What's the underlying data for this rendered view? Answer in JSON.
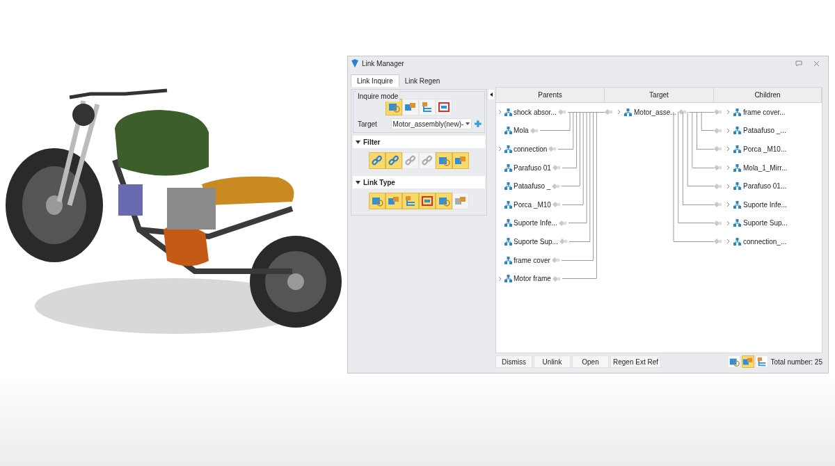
{
  "window": {
    "title": "Link Manager"
  },
  "tabs": [
    {
      "label": "Link Inquire",
      "selected": true
    },
    {
      "label": "Link Regen",
      "selected": false
    }
  ],
  "inquire_mode": {
    "label": "Inquire mode",
    "modes": [
      {
        "selected": true
      },
      {
        "selected": false
      },
      {
        "selected": false
      },
      {
        "selected": false
      }
    ],
    "target_label": "Target",
    "target_value": "Motor_assembly(new)-"
  },
  "filter": {
    "label": "Filter",
    "expanded": true,
    "toggles": [
      {
        "on": true
      },
      {
        "on": true
      },
      {
        "on": false
      },
      {
        "on": false
      },
      {
        "on": true
      },
      {
        "on": true
      }
    ]
  },
  "link_type": {
    "label": "Link Type",
    "expanded": true,
    "toggles": [
      {
        "on": true
      },
      {
        "on": true
      },
      {
        "on": true
      },
      {
        "on": true
      },
      {
        "on": true
      },
      {
        "on": false
      }
    ]
  },
  "columns": [
    "Parents",
    "Target",
    "Children"
  ],
  "parents": [
    {
      "label": "shock absor...",
      "expandable": true
    },
    {
      "label": "Mola",
      "expandable": false
    },
    {
      "label": "connection",
      "expandable": true
    },
    {
      "label": "Parafuso 01",
      "expandable": false
    },
    {
      "label": "Pataafuso _",
      "expandable": false
    },
    {
      "label": "Porca _M10",
      "expandable": false
    },
    {
      "label": "Suporte Infe...",
      "expandable": false
    },
    {
      "label": "Suporte Sup...",
      "expandable": false
    },
    {
      "label": "frame cover",
      "expandable": false
    },
    {
      "label": "Motor frame",
      "expandable": true
    }
  ],
  "target": {
    "label": "Motor_asse...",
    "expandable": true
  },
  "children": [
    {
      "label": "frame cover...",
      "expandable": true
    },
    {
      "label": "Pataafuso _...",
      "expandable": true
    },
    {
      "label": "Porca _M10...",
      "expandable": true
    },
    {
      "label": "Mola_1_Mirr...",
      "expandable": true
    },
    {
      "label": "Parafuso 01...",
      "expandable": true
    },
    {
      "label": "Suporte Infe...",
      "expandable": true
    },
    {
      "label": "Suporte Sup...",
      "expandable": true
    },
    {
      "label": "connection_...",
      "expandable": true
    }
  ],
  "buttons": [
    "Dismiss",
    "Unlink",
    "Open",
    "Regen Ext Ref"
  ],
  "status": {
    "toggles": [
      {
        "on": false
      },
      {
        "on": true
      },
      {
        "on": false
      }
    ],
    "total": "Total number: 25"
  }
}
